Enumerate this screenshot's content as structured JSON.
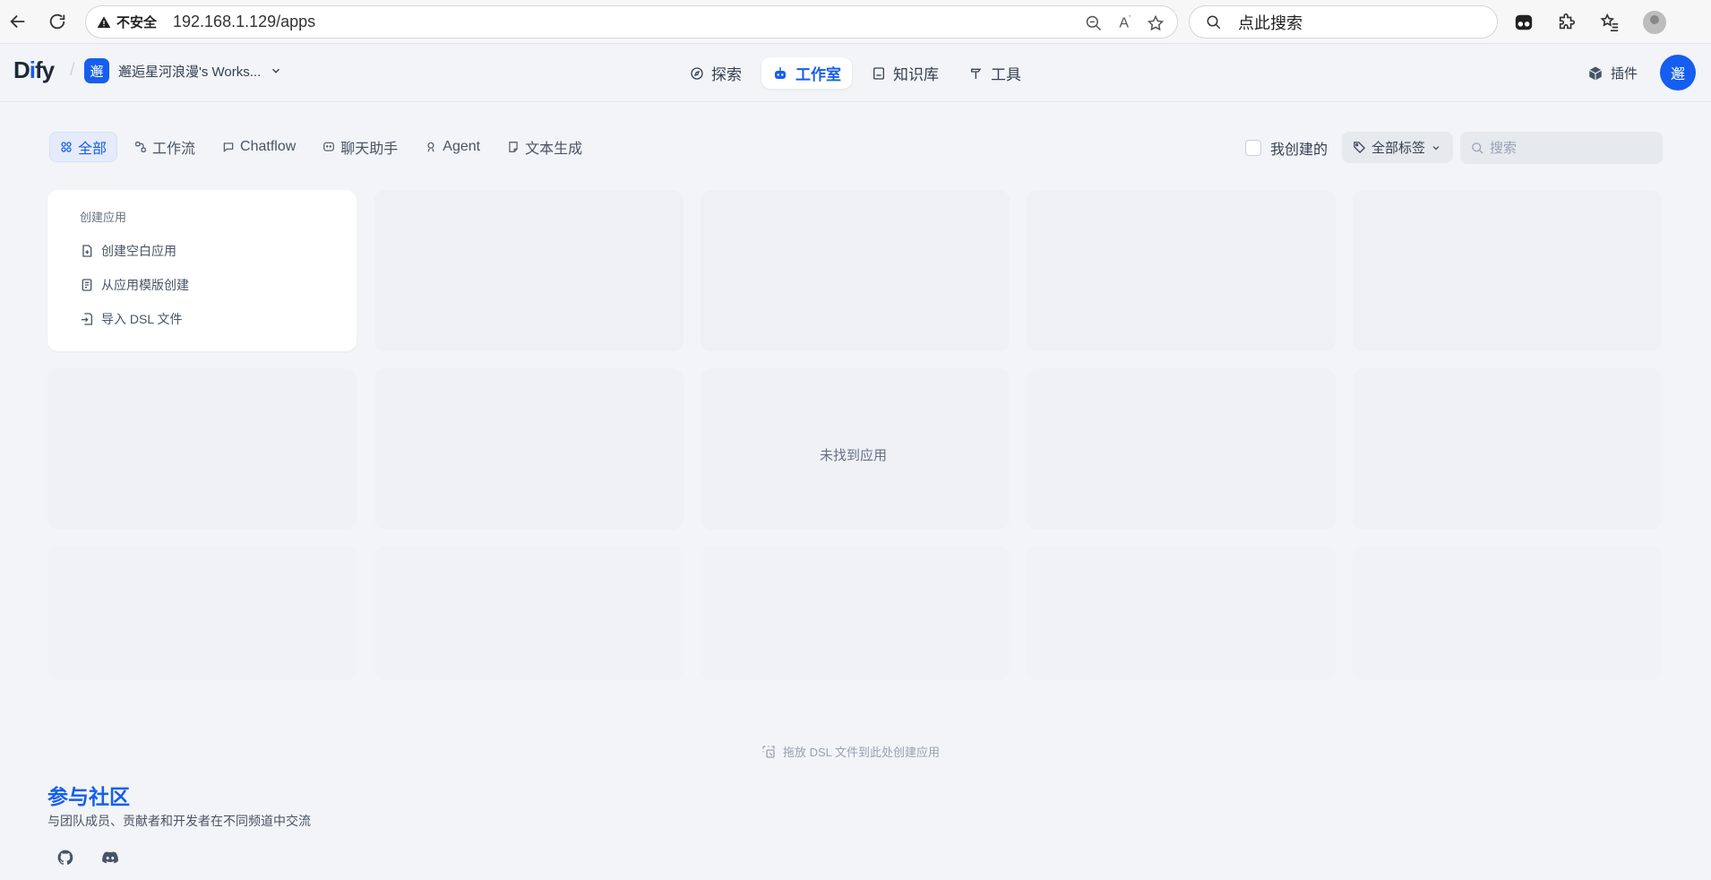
{
  "browser": {
    "insecure_label": "不安全",
    "url": "192.168.1.129/apps",
    "search_placeholder": "点此搜索"
  },
  "header": {
    "logo_pre": "D",
    "logo_i": "i",
    "logo_post": "fy",
    "workspace_badge": "邂",
    "workspace_name": "邂逅星河浪漫's Works...",
    "nav": [
      {
        "label": "探索",
        "icon": "compass-icon"
      },
      {
        "label": "工作室",
        "icon": "robot-icon",
        "active": true
      },
      {
        "label": "知识库",
        "icon": "book-icon"
      },
      {
        "label": "工具",
        "icon": "hammer-icon"
      }
    ],
    "plugins_label": "插件",
    "avatar_label": "邂"
  },
  "filters": {
    "tabs": [
      {
        "label": "全部",
        "icon": "grid-icon",
        "active": true
      },
      {
        "label": "工作流",
        "icon": "workflow-icon"
      },
      {
        "label": "Chatflow",
        "icon": "chatflow-icon"
      },
      {
        "label": "聊天助手",
        "icon": "chat-bot-icon"
      },
      {
        "label": "Agent",
        "icon": "agent-icon"
      },
      {
        "label": "文本生成",
        "icon": "text-gen-icon"
      }
    ],
    "mine_label": "我创建的",
    "tags_label": "全部标签",
    "search_placeholder": "搜索"
  },
  "create_card": {
    "title": "创建应用",
    "options": [
      "创建空白应用",
      "从应用模版创建",
      "导入 DSL 文件"
    ]
  },
  "empty_message": "未找到应用",
  "drop_hint": "拖放 DSL 文件到此处创建应用",
  "community": {
    "title": "参与社区",
    "subtitle": "与团队成员、贡献者和开发者在不同频道中交流",
    "links": [
      "github-icon",
      "discord-icon"
    ]
  }
}
